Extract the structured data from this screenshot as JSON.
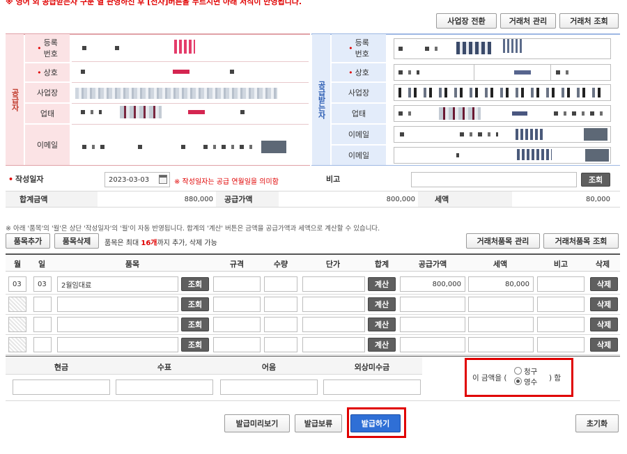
{
  "notice": "※ 영어 외 공급받는자 구분 열 판영하신 후 [전자]버튼을 누르시면 아래 서식이 만영됩니다.",
  "top_buttons": {
    "switch_workplace": "사업장 전환",
    "manage_client": "거래처 관리",
    "view_client": "거래처 조회"
  },
  "supplier": {
    "side_label": "공급자",
    "reg_no_label": "등록\n번호",
    "company_label": "상호",
    "workplace_label": "사업장",
    "business_label": "업태",
    "email_label": "이메일"
  },
  "receiver": {
    "side_label": "공급받는자",
    "reg_no_label": "등록\n번호",
    "company_label": "상호",
    "workplace_label": "사업장",
    "business_label": "업태",
    "email1_label": "이메일",
    "email2_label": "이메일"
  },
  "date_row": {
    "label": "작성일자",
    "date_value": "2023-03-03",
    "note": "※ 작성일자는 공급 연월일을 의미함",
    "memo_label": "비고",
    "search_button": "조회"
  },
  "totals": {
    "total_label": "합계금액",
    "total_value": "880,000",
    "supply_label": "공급가액",
    "supply_value": "800,000",
    "tax_label": "세액",
    "tax_value": "80,000"
  },
  "items_notice": "※ 아래 '품목'의 '월'은 상단 '작성일자'의 '월'이 자동 반영됩니다. 합계의 '계산' 버튼은 금액을 공급가액과 세액으로 계산할 수 있습니다.",
  "item_buttons": {
    "add": "품목추가",
    "delete": "품목삭제",
    "limit_prefix": "품목은 최대 ",
    "limit_count": "16개",
    "limit_suffix": "까지 추가, 삭제 가능",
    "manage_items": "거래처품목 관리",
    "view_items": "거래처품목 조회"
  },
  "item_headers": [
    "월",
    "일",
    "품목",
    "규격",
    "수량",
    "단가",
    "합계",
    "공급가액",
    "세액",
    "비고",
    "삭제"
  ],
  "item_rows": [
    {
      "month": "03",
      "day": "03",
      "name": "2월임대료",
      "search": "조회",
      "calc": "계산",
      "supply": "800,000",
      "tax": "80,000",
      "delete": "삭제"
    },
    {
      "month": "",
      "day": "",
      "name": "",
      "search": "조회",
      "calc": "계산",
      "supply": "",
      "tax": "",
      "delete": "삭제"
    },
    {
      "month": "",
      "day": "",
      "name": "",
      "search": "조회",
      "calc": "계산",
      "supply": "",
      "tax": "",
      "delete": "삭제"
    },
    {
      "month": "",
      "day": "",
      "name": "",
      "search": "조회",
      "calc": "계산",
      "supply": "",
      "tax": "",
      "delete": "삭제"
    }
  ],
  "payment": {
    "cash": "현금",
    "check": "수표",
    "bill": "어음",
    "credit": "외상미수금",
    "amount_prefix": "이 금액을 (",
    "claim": "청구",
    "receipt": "영수",
    "amount_suffix": ") 함",
    "selected": "영수"
  },
  "bottom_buttons": {
    "preview": "발급미리보기",
    "hold": "발급보류",
    "issue": "발급하기",
    "reset": "초기화"
  },
  "colors": {
    "accent_red": "#e00000",
    "issue_blue": "#2f6fd6",
    "supplier_pink": "#fbe3e5",
    "receiver_blue": "#e3ecfa"
  }
}
